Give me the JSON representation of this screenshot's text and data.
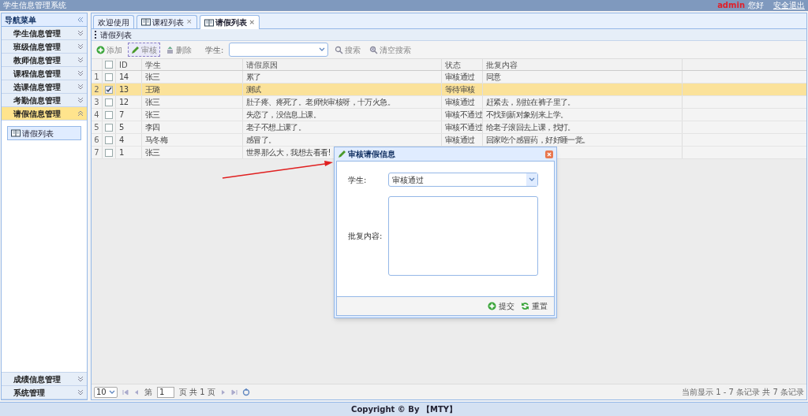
{
  "header": {
    "title": "学生信息管理系统",
    "user": "admin",
    "greeting": "您好",
    "logout": "安全退出"
  },
  "sidebar": {
    "title": "导航菜单",
    "groups": [
      {
        "label": "学生信息管理",
        "expanded": false
      },
      {
        "label": "班级信息管理",
        "expanded": false
      },
      {
        "label": "教师信息管理",
        "expanded": false
      },
      {
        "label": "课程信息管理",
        "expanded": false
      },
      {
        "label": "选课信息管理",
        "expanded": false
      },
      {
        "label": "考勤信息管理",
        "expanded": false
      },
      {
        "label": "请假信息管理",
        "expanded": true,
        "children": [
          {
            "label": "请假列表"
          }
        ]
      },
      {
        "label": "成绩信息管理",
        "expanded": false
      },
      {
        "label": "系统管理",
        "expanded": false
      }
    ]
  },
  "tabs": [
    {
      "label": "欢迎使用",
      "selected": false
    },
    {
      "label": "课程列表",
      "close": "×",
      "selected": false
    },
    {
      "label": "请假列表",
      "close": "×",
      "selected": true
    }
  ],
  "panel": {
    "title": "请假列表"
  },
  "toolbar": {
    "buttons": [
      {
        "kind": "add",
        "label": "添加",
        "focused": false
      },
      {
        "kind": "edit",
        "label": "审核",
        "focused": true
      },
      {
        "kind": "delete",
        "label": "删除",
        "focused": false
      }
    ],
    "filter": {
      "label": "学生:"
    },
    "search_buttons": [
      {
        "kind": "search",
        "label": "搜索"
      },
      {
        "kind": "clear",
        "label": "清空搜索"
      }
    ]
  },
  "table": {
    "header_checked": false,
    "columns": [
      "ID",
      "学生",
      "请假原因",
      "状态",
      "批复内容"
    ],
    "rows": [
      {
        "index": "1",
        "checked": false,
        "selected": false,
        "cells": [
          "14",
          "张三",
          "累了",
          "审核通过",
          "同意"
        ]
      },
      {
        "index": "2",
        "checked": true,
        "selected": true,
        "cells": [
          "13",
          "王璐",
          "测试",
          "等待审核"
        ]
      },
      {
        "index": "3",
        "checked": false,
        "selected": false,
        "cells": [
          "12",
          "张三",
          "肚子疼、疼死了。老师快审核呀，十万火急。",
          "审核通过",
          "赶紧去，别拉在裤子里了。"
        ]
      },
      {
        "index": "4",
        "checked": false,
        "selected": false,
        "cells": [
          "7",
          "张三",
          "失恋了，没信息上课。",
          "审核不通过",
          "不找到新对象别来上学。"
        ]
      },
      {
        "index": "5",
        "checked": false,
        "selected": false,
        "cells": [
          "5",
          "李四",
          "老子不想上课了。",
          "审核不通过",
          "给老子滚回去上课，找打。"
        ]
      },
      {
        "index": "6",
        "checked": false,
        "selected": false,
        "cells": [
          "4",
          "马冬梅",
          "感冒了。",
          "审核通过",
          "回家吃个感冒药，好好睡一觉。"
        ]
      },
      {
        "index": "7",
        "checked": false,
        "selected": false,
        "cells": [
          "1",
          "张三",
          "世界那么大，我想去看看!"
        ]
      }
    ]
  },
  "pagination": {
    "page_size": "10",
    "page_label": "第",
    "page": "1",
    "page_total": "页 共 1 页",
    "summary": "当前显示 1 - 7 条记录 共 7 条记录"
  },
  "dialog": {
    "title": "审核请假信息",
    "fields": [
      {
        "kind": "select",
        "label": "学生:",
        "value": "审核通过"
      },
      {
        "kind": "textarea",
        "label": "批复内容:"
      }
    ],
    "buttons": [
      {
        "kind": "submit",
        "label": "提交"
      },
      {
        "kind": "reset",
        "label": "重置"
      }
    ]
  },
  "footer": "Copyright © By 【MTY】"
}
